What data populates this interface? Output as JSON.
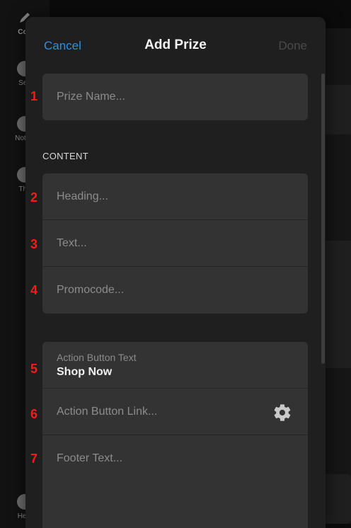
{
  "background": {
    "sidebar_items": [
      {
        "label": "Con",
        "icon": "pencil-icon"
      },
      {
        "label": "Sett",
        "icon": "gear-icon"
      },
      {
        "label": "Notific",
        "icon": "bell-icon"
      },
      {
        "label": "The",
        "icon": "palette-icon"
      },
      {
        "label": "Help",
        "icon": "help-icon"
      }
    ]
  },
  "modal": {
    "cancel_label": "Cancel",
    "title": "Add Prize",
    "done_label": "Done",
    "prize_name_placeholder": "Prize Name...",
    "content_section_label": "CONTENT",
    "heading_placeholder": "Heading...",
    "text_placeholder": "Text...",
    "promocode_placeholder": "Promocode...",
    "action_button_text_label": "Action Button Text",
    "action_button_text_value": "Shop Now",
    "action_button_link_placeholder": "Action Button Link...",
    "footer_text_placeholder": "Footer Text..."
  },
  "annotations": [
    "1",
    "2",
    "3",
    "4",
    "5",
    "6",
    "7"
  ],
  "colors": {
    "accent": "#2f8fe0",
    "annotation": "#ff1a1a",
    "modal_bg": "#1f1f1f",
    "field_bg": "#333333"
  }
}
